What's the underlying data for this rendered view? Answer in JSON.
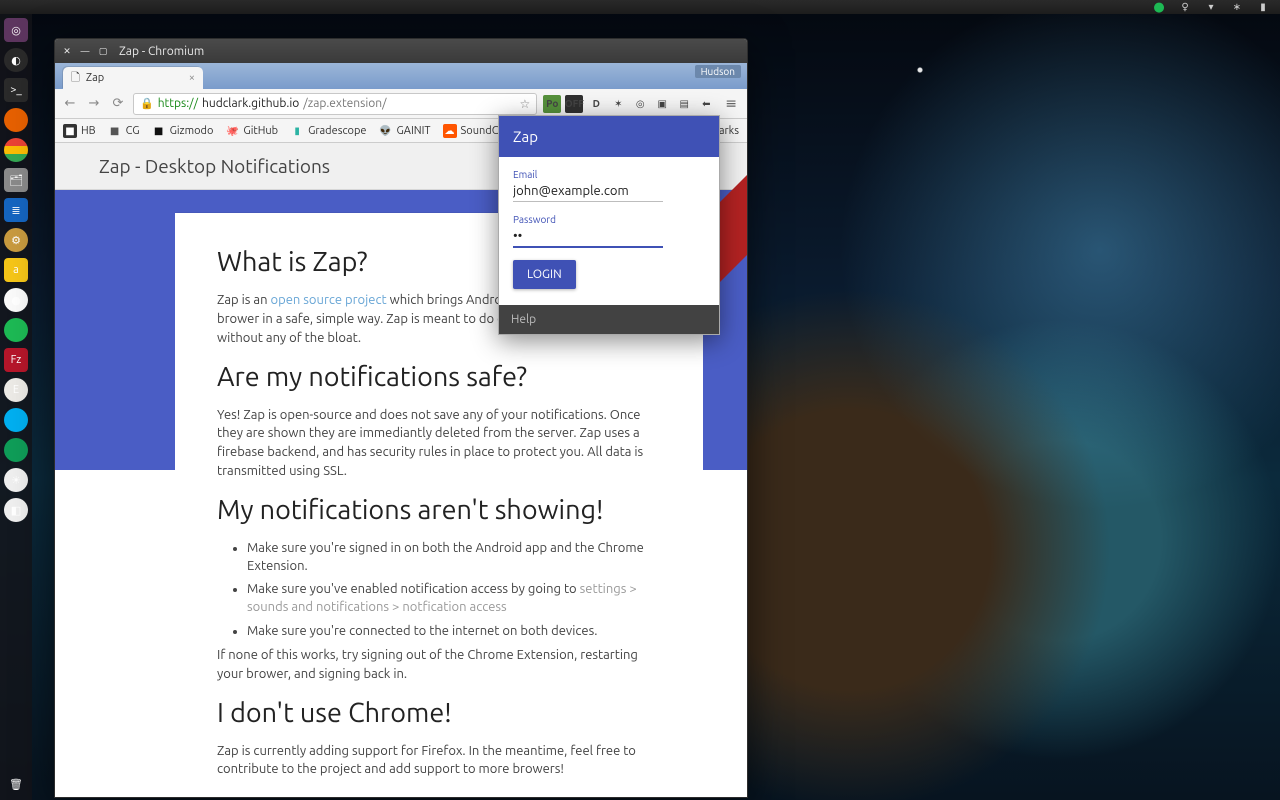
{
  "panel": {
    "indicators": [
      "spotify",
      "bulb",
      "wifi",
      "bluetooth",
      "battery"
    ]
  },
  "launcher": {
    "items": [
      {
        "name": "ubuntu-dash",
        "glyph": "◎",
        "cls": "c-ubu"
      },
      {
        "name": "wheel",
        "glyph": "◐",
        "cls": "c-term circle"
      },
      {
        "name": "terminal",
        "glyph": ">_",
        "cls": "c-term"
      },
      {
        "name": "firefox",
        "glyph": "",
        "cls": "c-ff circle"
      },
      {
        "name": "chromium",
        "glyph": "",
        "cls": "c-chrome circle"
      },
      {
        "name": "files",
        "glyph": "🗂",
        "cls": "c-files"
      },
      {
        "name": "writer",
        "glyph": "≣",
        "cls": "c-write"
      },
      {
        "name": "settings",
        "glyph": "⚙",
        "cls": "c-set circle"
      },
      {
        "name": "amazon",
        "glyph": "a",
        "cls": "c-yel"
      },
      {
        "name": "reddit",
        "glyph": "●",
        "cls": "c-red circle"
      },
      {
        "name": "spotify",
        "glyph": "",
        "cls": "c-spot circle"
      },
      {
        "name": "filezilla",
        "glyph": "Fz",
        "cls": "c-fz"
      },
      {
        "name": "app-e",
        "glyph": "E",
        "cls": "c-E circle"
      },
      {
        "name": "skype",
        "glyph": "",
        "cls": "c-skype circle"
      },
      {
        "name": "hangouts",
        "glyph": "",
        "cls": "c-han circle"
      },
      {
        "name": "app-dawn",
        "glyph": "☀",
        "cls": "c-dawn circle"
      },
      {
        "name": "color",
        "glyph": "◧",
        "cls": "c-dawn circle"
      }
    ],
    "trash": "🗑"
  },
  "window": {
    "title": "Zap - Chromium",
    "tab": {
      "title": "Zap"
    },
    "profile": "Hudson",
    "address": {
      "scheme": "https://",
      "host": "hudclark.github.io",
      "path": "/zap.extension/"
    },
    "bookmarks": [
      {
        "icon": "ico-hb",
        "label": "HB"
      },
      {
        "icon": "ico-cg",
        "label": "CG"
      },
      {
        "icon": "ico-giz",
        "label": "Gizmodo"
      },
      {
        "icon": "ico-gh",
        "label": "GitHub"
      },
      {
        "icon": "ico-gs",
        "label": "Gradescope"
      },
      {
        "icon": "ico-gn",
        "label": "GAINIT"
      },
      {
        "icon": "ico-sc",
        "label": "SoundCloud"
      }
    ],
    "bookmarks_overflow": "arks"
  },
  "page": {
    "header": "Zap - Desktop Notifications",
    "s1_title": "What is Zap?",
    "s1_pre": "Zap is an ",
    "s1_link": "open source project",
    "s1_post": " which brings Android notifications to your brower in a safe, simple way. Zap is meant to do one thing, and do it well, without any of the bloat.",
    "s2_title": "Are my notifications safe?",
    "s2_body": "Yes! Zap is open-source and does not save any of your notifications. Once they are shown they are immediantly deleted from the server. Zap uses a firebase backend, and has security rules in place to protect you. All data is transmitted using SSL.",
    "s3_title": "My notifications aren't showing!",
    "s3_li1": "Make sure you're signed in on both the Android app and the Chrome Extension.",
    "s3_li2_pre": "Make sure you've enabled notification access by going to ",
    "s3_li2_muted": "settings > sounds and notifications > notfication access",
    "s3_li3": "Make sure you're connected to the internet on both devices.",
    "s3_foot": "If none of this works, try signing out of the Chrome Extension, restarting your brower, and signing back in.",
    "s4_title": "I don't use Chrome!",
    "s4_body": "Zap is currently adding support for Firefox. In the meantime, feel free to contribute to the project and add support to more browers!"
  },
  "popup": {
    "title": "Zap",
    "email_label": "Email",
    "email_value": "john@example.com",
    "password_label": "Password",
    "password_value": "••",
    "login": "LOGIN",
    "help": "Help"
  }
}
